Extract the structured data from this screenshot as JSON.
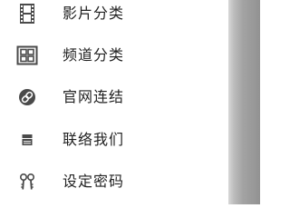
{
  "menu": {
    "items": [
      {
        "label": "影片分类",
        "icon": "film-icon"
      },
      {
        "label": "频道分类",
        "icon": "grid-icon"
      },
      {
        "label": "官网连结",
        "icon": "link-icon"
      },
      {
        "label": "联络我们",
        "icon": "contact-icon"
      },
      {
        "label": "设定密码",
        "icon": "key-icon"
      }
    ]
  },
  "colors": {
    "icon": "#4a4a4a",
    "text": "#222222",
    "background": "#ffffff"
  }
}
